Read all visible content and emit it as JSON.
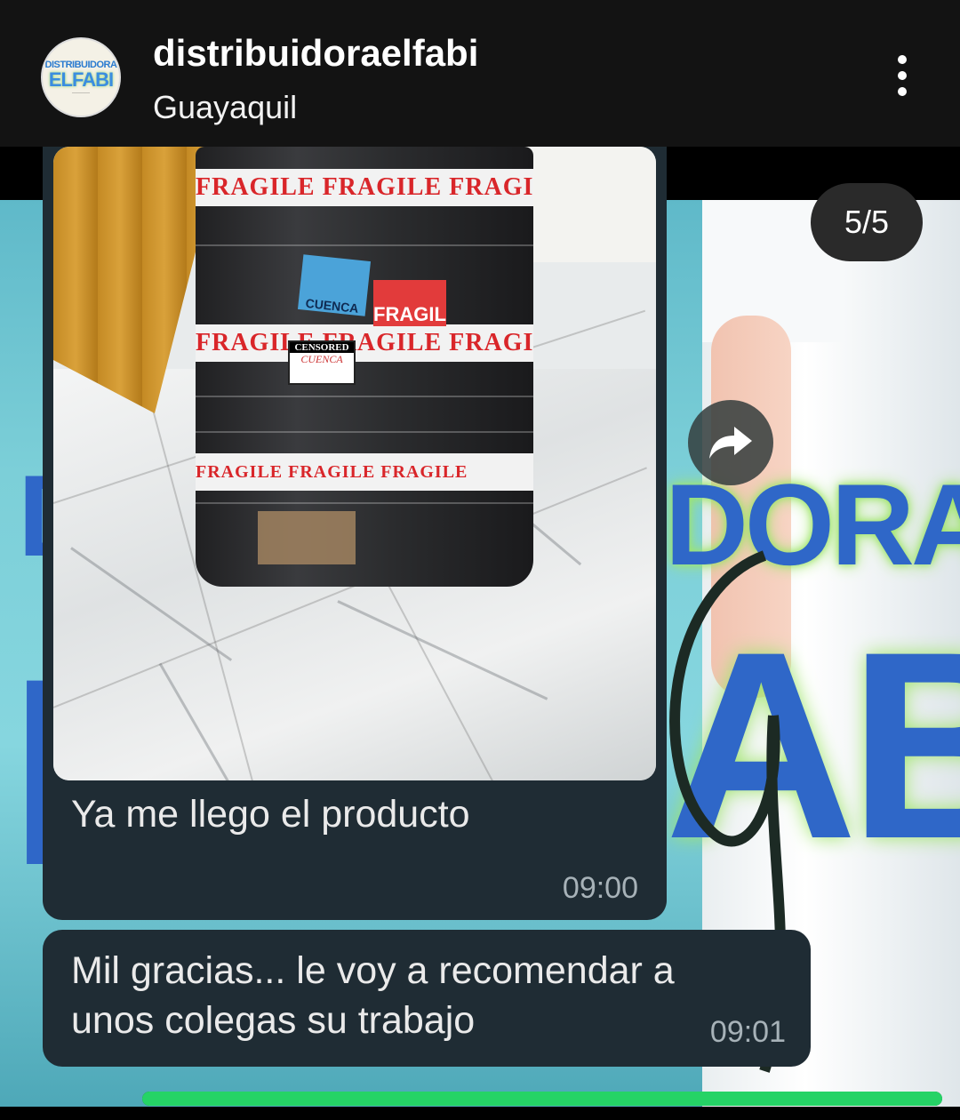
{
  "header": {
    "username": "distribuidoraelfabi",
    "location": "Guayaquil",
    "avatar_logo_top": "DISTRIBUIDORA",
    "avatar_logo_main": "ELFABI"
  },
  "story": {
    "counter": "5/5",
    "progress_fraction": 1.0,
    "background_text_top": "DORA",
    "background_text_bottom": "ABI"
  },
  "messages": [
    {
      "text": "Ya me llego el producto",
      "time": "09:00",
      "photo": {
        "tape_text": "FRAGILE FRAGILE FRAGILE",
        "sticker_blue": "CUENCA",
        "sticker_red": "FRAGIL",
        "sticker_censored": "CENSORED",
        "sticker_handwritten": "CUENCA"
      }
    },
    {
      "text": "Mil gracias... le voy a recomendar a unos colegas su trabajo",
      "time": "09:01"
    }
  ],
  "colors": {
    "header_bg": "#131313",
    "bubble_bg": "#1f2c34",
    "timestamp": "#a7b2b8",
    "progress": "#25d366",
    "brand_blue": "#2f67c8"
  },
  "icons": {
    "more": "more-vertical-icon",
    "share": "share-arrow-icon"
  }
}
